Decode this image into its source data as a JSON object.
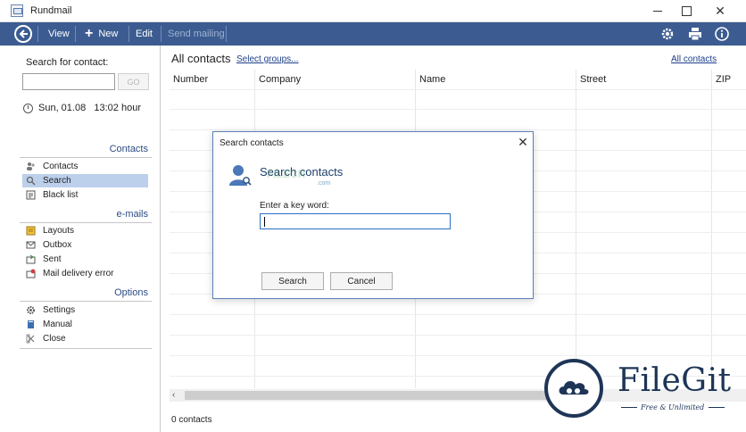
{
  "window": {
    "title": "Rundmail"
  },
  "toolbar": {
    "view_label": "View",
    "new_label": "New",
    "edit_label": "Edit",
    "send_mailing_label": "Send mailing",
    "icons": [
      "back-icon",
      "gear-icon",
      "printer-icon",
      "info-icon"
    ]
  },
  "sidebar": {
    "search_label": "Search for contact:",
    "search_value": "",
    "go_label": "GO",
    "datetime": "Sun, 01.08   13:02 hour",
    "sections": [
      {
        "header": "Contacts",
        "items": [
          {
            "label": "Contacts",
            "icon": "contacts-icon",
            "selected": false
          },
          {
            "label": "Search",
            "icon": "search-icon",
            "selected": true
          },
          {
            "label": "Black list",
            "icon": "blacklist-icon",
            "selected": false
          }
        ]
      },
      {
        "header": "e-mails",
        "items": [
          {
            "label": "Layouts",
            "icon": "layouts-icon",
            "selected": false
          },
          {
            "label": "Outbox",
            "icon": "outbox-icon",
            "selected": false
          },
          {
            "label": "Sent",
            "icon": "sent-icon",
            "selected": false
          },
          {
            "label": "Mail delivery error",
            "icon": "mail-error-icon",
            "selected": false
          }
        ]
      },
      {
        "header": "Options",
        "items": [
          {
            "label": "Settings",
            "icon": "gear-icon",
            "selected": false
          },
          {
            "label": "Manual",
            "icon": "book-icon",
            "selected": false
          },
          {
            "label": "Close",
            "icon": "close-icon",
            "selected": false
          }
        ]
      }
    ]
  },
  "main": {
    "title": "All contacts",
    "select_groups_link": "Select groups...",
    "all_contacts_link": "All contacts",
    "columns": [
      "Number",
      "Company",
      "Name",
      "Street",
      "ZIP"
    ],
    "status": "0 contacts"
  },
  "dialog": {
    "title": "Search contacts",
    "heading": "Search contacts",
    "keyword_label": "Enter a key word:",
    "keyword_value": "",
    "search_button": "Search",
    "cancel_button": "Cancel"
  },
  "watermarks": {
    "filecr_text": "FILECR",
    "filecr_domain": ".com",
    "brand_name": "FileGit",
    "brand_tagline": "Free & Unlimited"
  },
  "colors": {
    "toolbar_bg": "#3c5c91",
    "selected_item": "#bcd0ec",
    "section_header": "#2a4c84",
    "brand": "#1e3557"
  }
}
